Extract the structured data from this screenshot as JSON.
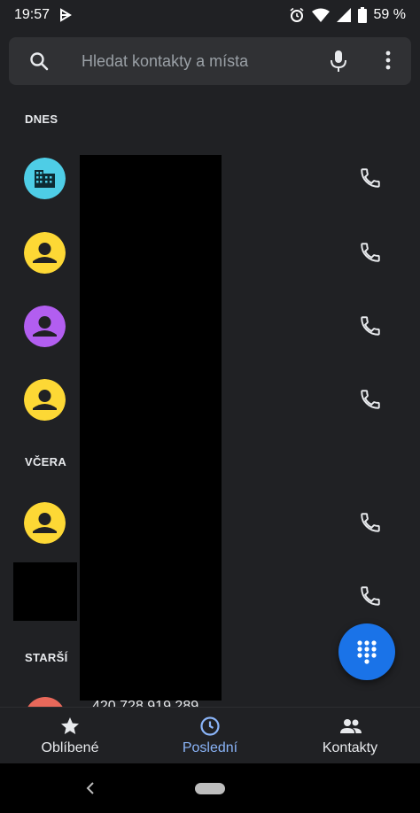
{
  "status_bar": {
    "time": "19:57",
    "battery": "59 %",
    "icons": [
      "play-protect-icon",
      "alarm-icon",
      "wifi-icon",
      "signal-icon",
      "battery-icon"
    ]
  },
  "search": {
    "placeholder": "Hledat kontakty a místa",
    "icons": [
      "search-icon",
      "mic-icon",
      "more-vert-icon"
    ]
  },
  "sections": {
    "today": "DNES",
    "yesterday": "VČERA",
    "older": "STARŠÍ"
  },
  "rows": [
    {
      "section": "DNES",
      "avatar": "business-avatar",
      "avatar_color": "#4ecde6"
    },
    {
      "section": "DNES",
      "avatar": "person-avatar",
      "avatar_color": "#fdd835"
    },
    {
      "section": "DNES",
      "avatar": "person-avatar",
      "avatar_color": "#b25ef0"
    },
    {
      "section": "DNES",
      "avatar": "person-avatar",
      "avatar_color": "#fdd835"
    },
    {
      "section": "VČERA",
      "avatar": "person-avatar",
      "avatar_color": "#fdd835"
    },
    {
      "section": "VČERA",
      "avatar": "redacted"
    },
    {
      "section": "STARŠÍ",
      "avatar": "partial",
      "avatar_color": "#e8685a",
      "number_partial": "420 728 919 289"
    }
  ],
  "fab": {
    "icon": "dialpad-icon",
    "color": "#1a73e8"
  },
  "bottom_nav": {
    "items": [
      {
        "label": "Oblíbené",
        "icon": "star-icon"
      },
      {
        "label": "Poslední",
        "icon": "clock-icon",
        "active": true
      },
      {
        "label": "Kontakty",
        "icon": "people-icon"
      }
    ]
  },
  "colors": {
    "background": "#202124",
    "accent": "#8ab4f8",
    "search_bg": "#303134"
  }
}
